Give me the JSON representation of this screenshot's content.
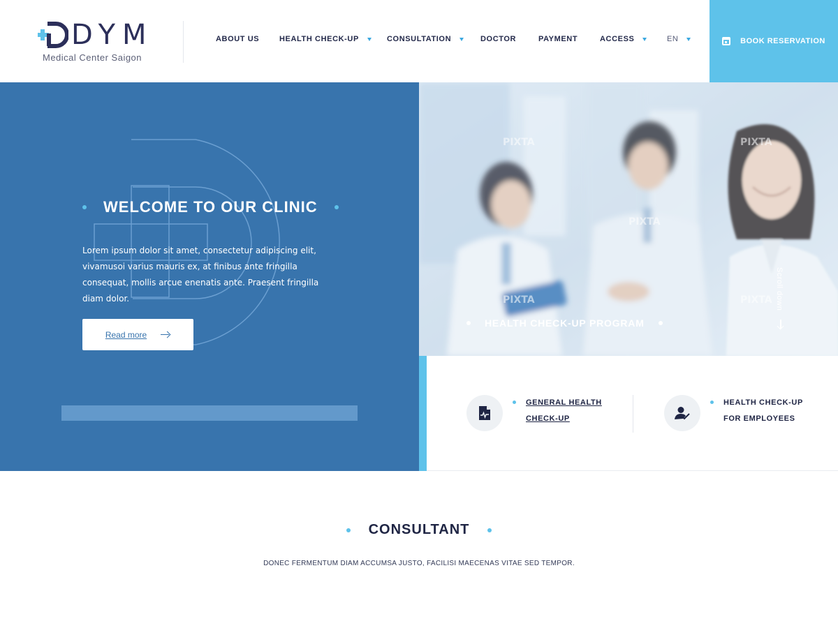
{
  "logo": {
    "text": "DYM",
    "subtitle": "Medical Center Saigon"
  },
  "nav": {
    "items": [
      {
        "label": "ABOUT US",
        "dropdown": false
      },
      {
        "label": "HEALTH CHECK-UP",
        "dropdown": true
      },
      {
        "label": "CONSULTATION",
        "dropdown": true
      },
      {
        "label": "DOCTOR",
        "dropdown": false
      },
      {
        "label": "PAYMENT",
        "dropdown": false
      },
      {
        "label": "ACCESS",
        "dropdown": true
      }
    ],
    "language": "EN",
    "book_button": "BOOK RESERVATION"
  },
  "hero": {
    "title": "WELCOME TO OUR CLINIC",
    "text": "Lorem ipsum dolor sit amet, consectetur adipiscing elit, vivamusoi varius mauris ex, at finibus ante fringilla consequat, mollis arcue enenatis ante. Praesent fringilla diam dolor.",
    "read_more": "Read more",
    "photo_caption": "HEALTH CHECK-UP PROGRAM",
    "scroll_label": "Scroll down",
    "watermark_text": "PIXTA"
  },
  "services": [
    {
      "line1": "GENERAL HEALTH",
      "line2": "CHECK-UP",
      "icon": "medical-document-icon"
    },
    {
      "line1": "HEALTH CHECK-UP",
      "line2": "FOR EMPLOYEES",
      "icon": "user-check-icon"
    }
  ],
  "consultant": {
    "title": "CONSULTANT",
    "subtitle": "DONEC FERMENTUM DIAM ACCUMSA JUSTO, FACILISI MAECENAS VITAE SED TEMPOR."
  },
  "colors": {
    "primary_blue": "#3874ad",
    "accent_cyan": "#5ec2ea",
    "navy_text": "#1f2544"
  }
}
